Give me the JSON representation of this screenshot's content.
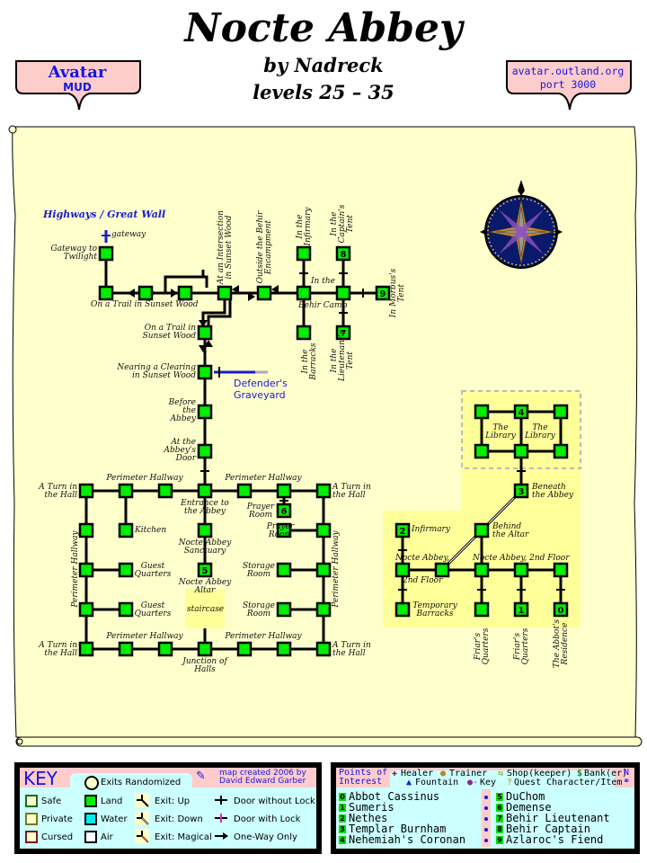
{
  "header": {
    "title": "Nocte Abbey",
    "author": "by Nadreck",
    "levels": "levels 25 – 35",
    "left_badge": {
      "line1": "Avatar",
      "line2": "MUD"
    },
    "right_badge": {
      "line1": "avatar.outland.org",
      "line2": "port 3000"
    }
  },
  "map": {
    "region_label": "Highways / Great Wall",
    "exit_labels": {
      "gateway": "gateway",
      "graveyard": "Defender's Graveyard",
      "staircase": "staircase"
    },
    "rooms": {
      "gateway_twilight": "Gateway to Twilight",
      "trail_sunset": "On a Trail in Sunset Wood",
      "trail_sunset2": "On a Trail in Sunset Wood",
      "intersection": "At an Intersection in Sunset Wood",
      "outside_behir": "Outside the Behir Encampment",
      "nearing_clearing": "Nearing a Clearing in Sunset Wood",
      "before_abbey": "Before the Abbey",
      "abbey_door": "At the Abbey's Door",
      "behir_camp_a": "In the",
      "behir_camp_b": "Behir Camp",
      "infirmary_tent": "In the Infirmary",
      "captains_tent": "In the Captain's Tent",
      "morbus_tent": "In Morbus's Tent",
      "barracks": "In the Barracks",
      "lieutenants_tent": "In the Lieutenant's Tent",
      "perimeter": "Perimeter Hallway",
      "turn_hall": "A Turn in the Hall",
      "entrance": "Entrance to the Abbey",
      "kitchen": "Kitchen",
      "sanctuary": "Nocte Abbey Sanctuary",
      "altar": "Nocte Abbey Altar",
      "guest": "Guest Quarters",
      "prayer": "Prayer Room",
      "storage": "Storage Room",
      "junction": "Junction of Halls",
      "library": "The Library",
      "beneath": "Beneath the Abbey",
      "behind_altar": "Behind the Altar",
      "infirmary": "Infirmary",
      "second_floor_a": "Nocte Abbey,",
      "second_floor_b": "2nd Floor",
      "second_floor_full": "Nocte Abbey, 2nd Floor",
      "temp_barracks": "Temporary Barracks",
      "friars": "Friar's Quarters",
      "abbots": "The Abbot's Residence"
    },
    "colors": {
      "land": "#00ee00",
      "parchment": "#ffffcc",
      "highlight": "#ffff99",
      "exit_blue": "#1a1ad0"
    }
  },
  "key": {
    "title": "KEY",
    "exits_randomized": "Exits Randomized",
    "credit_line1": "map created 2006 by",
    "credit_line2": "David Edward Garber",
    "zones": [
      "Safe",
      "Private",
      "Cursed"
    ],
    "terrain": [
      "Land",
      "Water",
      "Air"
    ],
    "exits": [
      "Exit: Up",
      "Exit: Down",
      "Exit: Magical"
    ],
    "doors": [
      "Door without Lock",
      "Door with Lock",
      "One-Way Only"
    ]
  },
  "poi": {
    "title_line1": "Points of",
    "title_line2": "Interest",
    "legend_row1": [
      "Healer",
      "Trainer",
      "Shop(keeper)",
      "Bank(er)"
    ],
    "legend_row2": [
      "Fountain",
      "Key",
      "Quest Character/Item"
    ],
    "north": "N",
    "entries": [
      {
        "n": "0",
        "name": "Abbot Cassinus"
      },
      {
        "n": "1",
        "name": "Sumeris"
      },
      {
        "n": "2",
        "name": "Nethes"
      },
      {
        "n": "3",
        "name": "Templar Burnham"
      },
      {
        "n": "4",
        "name": "Nehemiah's Coronan"
      },
      {
        "n": "5",
        "name": "DuChom"
      },
      {
        "n": "6",
        "name": "Demense"
      },
      {
        "n": "7",
        "name": "Behir Lieutenant"
      },
      {
        "n": "8",
        "name": "Behir Captain"
      },
      {
        "n": "9",
        "name": "Azlaroc's Fiend"
      }
    ]
  }
}
